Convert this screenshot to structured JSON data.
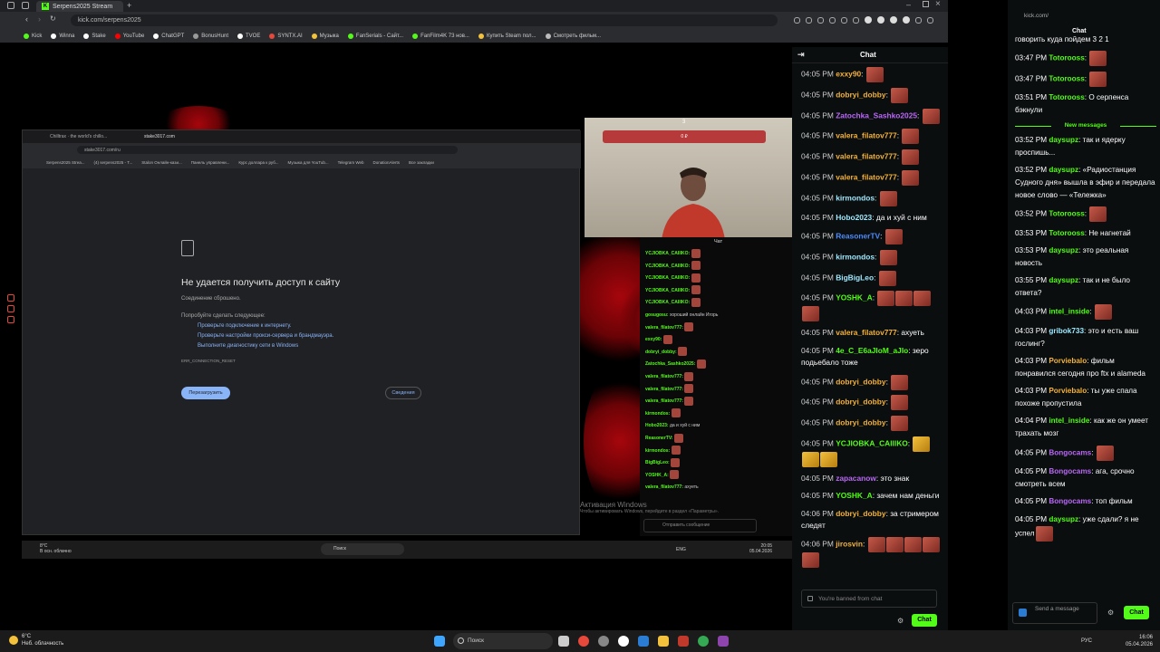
{
  "browser": {
    "tab_title": "Serpens2025 Stream",
    "url": "kick.com/serpens2025",
    "bookmarks": [
      {
        "label": "Kick",
        "color": "#53fc18"
      },
      {
        "label": "Winna",
        "color": "#ffffff"
      },
      {
        "label": "Stake",
        "color": "#ffffff"
      },
      {
        "label": "YouTube",
        "color": "#ff0000"
      },
      {
        "label": "ChatGPT",
        "color": "#ffffff"
      },
      {
        "label": "BonusHunt",
        "color": "#999999"
      },
      {
        "label": "TVOE",
        "color": "#ffffff"
      },
      {
        "label": "SYNTX.AI",
        "color": "#e6483b"
      },
      {
        "label": "Музыка",
        "color": "#f3c13b"
      },
      {
        "label": "FanSerials - Сайт...",
        "color": "#53fc18"
      },
      {
        "label": "FanFilm4K 73 нов...",
        "color": "#53fc18"
      },
      {
        "label": "Купить Steam пол...",
        "color": "#f3c13b"
      },
      {
        "label": "Смотреть фильм...",
        "color": "#bbbbbb"
      }
    ]
  },
  "stream": {
    "inner_browser": {
      "tabs": [
        "Chilltrax · the world's chillo...",
        "stake3017.com"
      ],
      "url": "stake3017.com/ru",
      "bookmarks": [
        "Serpens2025 Strea...",
        "(4) serpens2025 - T...",
        "Stalon Онлайн-кази...",
        "Панель управлени...",
        "Курс доллара к руб...",
        "Музыка для YouTub...",
        "Telegram Web",
        "DonationAlerts",
        "Все закладки"
      ],
      "error_title": "Не удается получить доступ к сайту",
      "error_sub": "Соединение сброшено.",
      "try_label": "Попробуйте сделать следующее:",
      "tips": [
        "Проверьте подключение к интернету.",
        "Проверьте настройки прокси-сервера и брандмауэра.",
        "Выполните диагностику сети в Windows"
      ],
      "error_code": "ERR_CONNECTION_RESET",
      "reload_label": "Перезагрузить",
      "details_label": "Сведения"
    },
    "cam_bar_label": "0 ₽",
    "cam_top_label": "3",
    "minichat_title": "Чат",
    "minichat_lines": [
      {
        "user": "YCJIOBKA_CAIIIKO:",
        "text": ""
      },
      {
        "user": "YCJIOBKA_CAIIIKO:",
        "text": ""
      },
      {
        "user": "YCJIOBKA_CAIIIKO:",
        "text": ""
      },
      {
        "user": "YCJIOBKA_CAIIIKO:",
        "text": ""
      },
      {
        "user": "YCJIOBKA_CAIIIKO:",
        "text": ""
      },
      {
        "user": "gosugosu:",
        "text": "хороший онлайн Игорь"
      },
      {
        "user": "valera_filatov777:",
        "text": ""
      },
      {
        "user": "exxy90:",
        "text": ""
      },
      {
        "user": "dobryi_dobby:",
        "text": ""
      },
      {
        "user": "Zatochka_Sashko2025:",
        "text": ""
      },
      {
        "user": "valera_filatov777:",
        "text": ""
      },
      {
        "user": "valera_filatov777:",
        "text": ""
      },
      {
        "user": "valera_filatov777:",
        "text": ""
      },
      {
        "user": "kirmondos:",
        "text": ""
      },
      {
        "user": "Hobo2023:",
        "text": "да и хуй с ним"
      },
      {
        "user": "ReasonerTV:",
        "text": ""
      },
      {
        "user": "kirmondos:",
        "text": ""
      },
      {
        "user": "BigBigLeo:",
        "text": ""
      },
      {
        "user": "YOSHK_A:",
        "text": ""
      },
      {
        "user": "valera_filatov777:",
        "text": "ахуеть"
      }
    ],
    "minichat_placeholder": "Отправить сообщение",
    "windows_watermark": "Активация Windows",
    "windows_watermark_sub": "Чтобы активировать Windows, перейдите в раздел «Параметры».",
    "inner_taskbar": {
      "temp": "8°C",
      "weather": "В осн. облачно",
      "search": "Поиск",
      "lang": "ENG",
      "time": "20:05",
      "date": "05.04.2026"
    }
  },
  "chat": {
    "title": "Chat",
    "messages": [
      {
        "time": "04:05 PM",
        "user": "valera_filatov777",
        "color": "#f3b23b",
        "text": "",
        "emotes": 1
      },
      {
        "time": "04:05 PM",
        "user": "exxy90",
        "color": "#f3b23b",
        "text": "",
        "emotes": 1
      },
      {
        "time": "04:05 PM",
        "user": "dobryi_dobby",
        "color": "#f3b23b",
        "text": "",
        "emotes": 1
      },
      {
        "time": "04:05 PM",
        "user": "Zatochka_Sashko2025",
        "color": "#b868f5",
        "text": "",
        "emotes": 1
      },
      {
        "time": "04:05 PM",
        "user": "valera_filatov777",
        "color": "#f3b23b",
        "text": "",
        "emotes": 1
      },
      {
        "time": "04:05 PM",
        "user": "valera_filatov777",
        "color": "#f3b23b",
        "text": "",
        "emotes": 1
      },
      {
        "time": "04:05 PM",
        "user": "valera_filatov777",
        "color": "#f3b23b",
        "text": "",
        "emotes": 1
      },
      {
        "time": "04:05 PM",
        "user": "kirmondos",
        "color": "#9ee9ff",
        "text": "",
        "emotes": 1
      },
      {
        "time": "04:05 PM",
        "user": "Hobo2023",
        "color": "#9ee9ff",
        "text": "да и хуй с ним",
        "emotes": 0
      },
      {
        "time": "04:05 PM",
        "user": "ReasonerTV",
        "color": "#4d8cff",
        "text": "",
        "emotes": 1
      },
      {
        "time": "04:05 PM",
        "user": "kirmondos",
        "color": "#9ee9ff",
        "text": "",
        "emotes": 1
      },
      {
        "time": "04:05 PM",
        "user": "BigBigLeo",
        "color": "#9ee9ff",
        "text": "",
        "emotes": 1
      },
      {
        "time": "04:05 PM",
        "user": "YOSHK_A",
        "color": "#53fc18",
        "text": "",
        "emotes": 4
      },
      {
        "time": "04:05 PM",
        "user": "valera_filatov777",
        "color": "#f3b23b",
        "text": "ахуеть",
        "emotes": 0
      },
      {
        "time": "04:05 PM",
        "user": "4e_C_E6aJIoM_aJIo",
        "color": "#53fc18",
        "text": "зеро подьебало тоже",
        "emotes": 0
      },
      {
        "time": "04:05 PM",
        "user": "dobryi_dobby",
        "color": "#f3b23b",
        "text": "",
        "emotes": 1
      },
      {
        "time": "04:05 PM",
        "user": "dobryi_dobby",
        "color": "#f3b23b",
        "text": "",
        "emotes": 1
      },
      {
        "time": "04:05 PM",
        "user": "dobryi_dobby",
        "color": "#f3b23b",
        "text": "",
        "emotes": 1
      },
      {
        "time": "04:05 PM",
        "user": "YCJIOBKA_CAIIIKO",
        "color": "#53fc18",
        "text": "",
        "emotes": 3
      },
      {
        "time": "04:05 PM",
        "user": "zapacanow",
        "color": "#b868f5",
        "text": "это знак",
        "emotes": 0
      },
      {
        "time": "04:05 PM",
        "user": "YOSHK_A",
        "color": "#53fc18",
        "text": "зачем нам деньги",
        "emotes": 0
      },
      {
        "time": "04:06 PM",
        "user": "dobryi_dobby",
        "color": "#f3b23b",
        "text": "за стримером следят",
        "emotes": 0
      },
      {
        "time": "04:06 PM",
        "user": "jirosvin",
        "color": "#f3b23b",
        "text": "",
        "emotes": 5
      }
    ],
    "banned_placeholder": "You're banned from chat",
    "chat_button": "Chat"
  },
  "right_panel": {
    "url": "kick.com/",
    "title": "Chat",
    "top_text": "говорить куда пойдем 3 2 1",
    "messages": [
      {
        "time": "03:47 PM",
        "user": "Totorooss",
        "color": "#53fc18",
        "text": "",
        "emotes": 1
      },
      {
        "time": "03:47 PM",
        "user": "Totorooss",
        "color": "#53fc18",
        "text": "",
        "emotes": 1
      },
      {
        "time": "03:51 PM",
        "user": "Totorooss",
        "color": "#53fc18",
        "text": "О серпенса бэкнули",
        "emotes": 0
      }
    ],
    "new_messages_label": "New messages",
    "messages_new": [
      {
        "time": "03:52 PM",
        "user": "daysupz",
        "color": "#53fc18",
        "text": "так и ядерку проспишь...",
        "emotes": 0
      },
      {
        "time": "03:52 PM",
        "user": "daysupz",
        "color": "#53fc18",
        "text": "«Радиостанция Судного дня» вышла в эфир и передала новое слово — «Тележка»",
        "emotes": 0
      },
      {
        "time": "03:52 PM",
        "user": "Totorooss",
        "color": "#53fc18",
        "text": "",
        "emotes": 1
      },
      {
        "time": "03:53 PM",
        "user": "Totorooss",
        "color": "#53fc18",
        "text": "Не нагнетай",
        "emotes": 0
      },
      {
        "time": "03:53 PM",
        "user": "daysupz",
        "color": "#53fc18",
        "text": "это реальная новость",
        "emotes": 0
      },
      {
        "time": "03:55 PM",
        "user": "daysupz",
        "color": "#53fc18",
        "text": "так и не было ответа?",
        "emotes": 0
      },
      {
        "time": "04:03 PM",
        "user": "intel_inside",
        "color": "#53fc18",
        "text": "",
        "emotes": 1
      },
      {
        "time": "04:03 PM",
        "user": "gribok733",
        "color": "#9ee9ff",
        "text": "это и есть ваш гослинг?",
        "emotes": 0
      },
      {
        "time": "04:03 PM",
        "user": "Porviebalo",
        "color": "#f3b23b",
        "text": "фильм понравился сегодня про ftx и alameda",
        "emotes": 0
      },
      {
        "time": "04:03 PM",
        "user": "Porviebalo",
        "color": "#f3b23b",
        "text": "ты уже спала похоже пропустила",
        "emotes": 0
      },
      {
        "time": "04:04 PM",
        "user": "intel_inside",
        "color": "#53fc18",
        "text": "как же он умеет трахать мозг",
        "emotes": 0
      },
      {
        "time": "04:05 PM",
        "user": "Bongocams",
        "color": "#b868f5",
        "text": "",
        "emotes": 1
      },
      {
        "time": "04:05 PM",
        "user": "Bongocams",
        "color": "#b868f5",
        "text": "ага, срочно смотреть всем",
        "emotes": 0
      },
      {
        "time": "04:05 PM",
        "user": "Bongocams",
        "color": "#b868f5",
        "text": "топ фильм",
        "emotes": 0
      },
      {
        "time": "04:05 PM",
        "user": "daysupz",
        "color": "#53fc18",
        "text": "уже сдали? я не успел",
        "emotes": 1
      }
    ],
    "send_placeholder": "Send a message",
    "chat_button": "Chat"
  },
  "taskbar": {
    "temp": "6°C",
    "weather": "Неб. облачность",
    "search": "Поиск",
    "lang": "РУС",
    "time": "16:06",
    "date": "05.04.2026"
  }
}
